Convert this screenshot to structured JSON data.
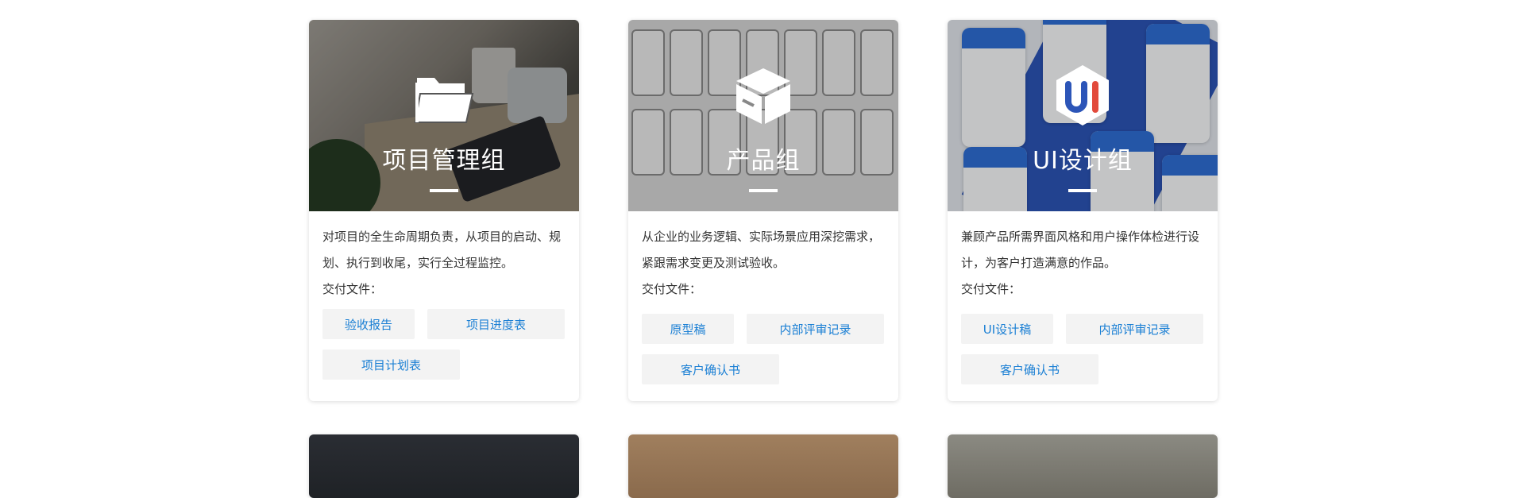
{
  "cards": [
    {
      "title": "项目管理组",
      "icon": "folder-icon",
      "description": "对项目的全生命周期负责，从项目的启动、规划、执行到收尾，实行全过程监控。",
      "deliverables_label": "交付文件：",
      "deliverables": [
        "验收报告",
        "项目进度表",
        "项目计划表"
      ]
    },
    {
      "title": "产品组",
      "icon": "box-icon",
      "description": "从企业的业务逻辑、实际场景应用深挖需求，紧跟需求变更及测试验收。",
      "deliverables_label": "交付文件：",
      "deliverables": [
        "原型稿",
        "内部评审记录",
        "客户确认书"
      ]
    },
    {
      "title": "UI设计组",
      "icon": "ui-logo-icon",
      "description": "兼顾产品所需界面风格和用户操作体检进行设计，为客户打造满意的作品。",
      "deliverables_label": "交付文件：",
      "deliverables": [
        "UI设计稿",
        "内部评审记录",
        "客户确认书"
      ]
    }
  ],
  "colors": {
    "tag_text": "#1a7fd4",
    "tag_bg": "#f3f3f3",
    "ui_logo_blue": "#2c55b8"
  }
}
